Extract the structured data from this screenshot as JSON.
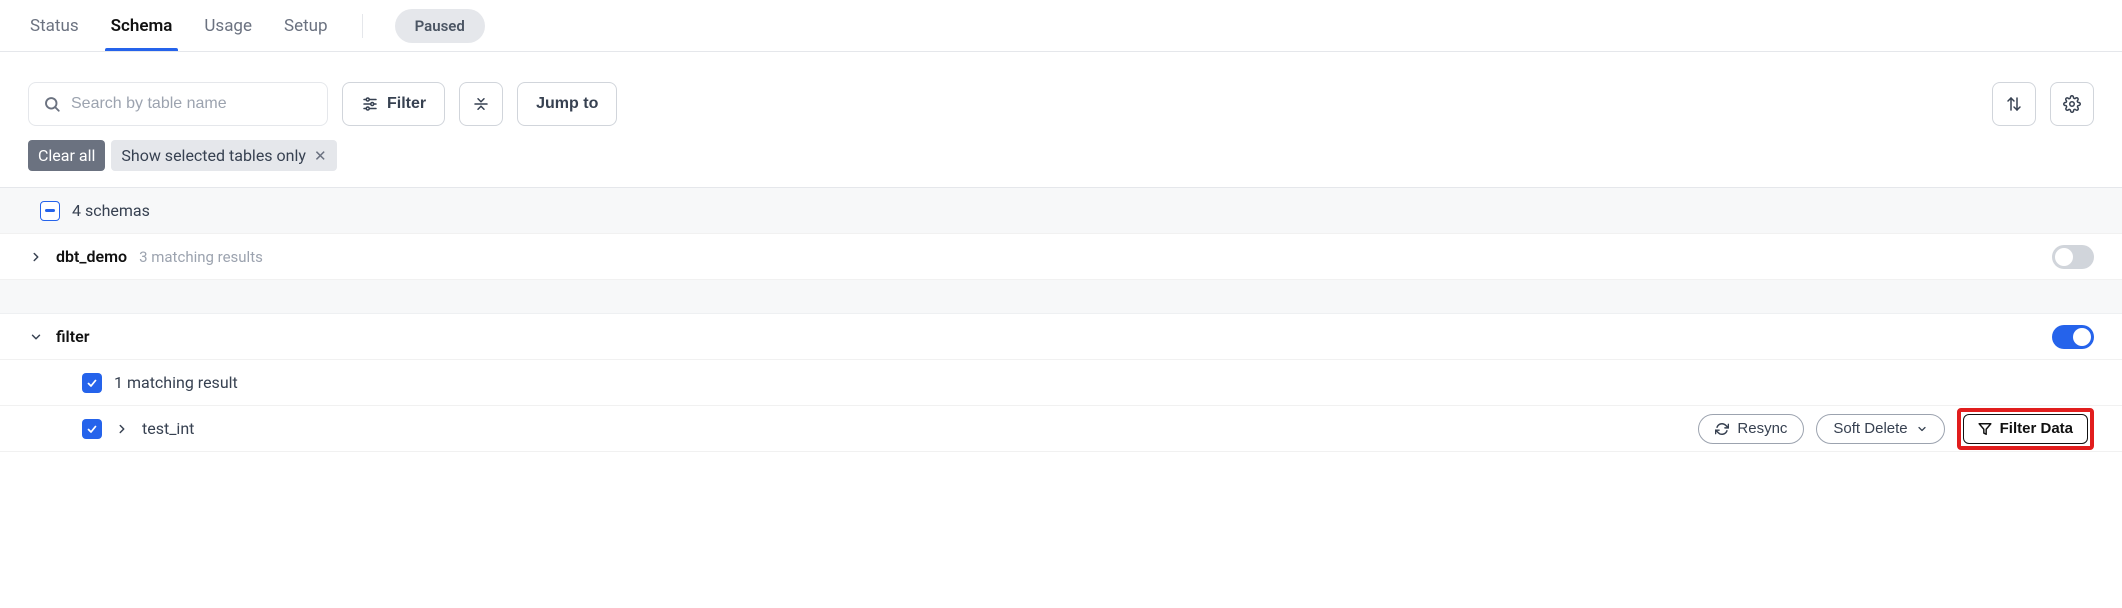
{
  "tabs": {
    "status": "Status",
    "schema": "Schema",
    "usage": "Usage",
    "setup": "Setup"
  },
  "status_pill": "Paused",
  "toolbar": {
    "search_placeholder": "Search by table name",
    "filter_label": "Filter",
    "jump_label": "Jump to"
  },
  "chips": {
    "clear_all": "Clear all",
    "show_selected": "Show selected tables only"
  },
  "header_row": {
    "schema_count": "4 schemas"
  },
  "schemas": [
    {
      "name": "dbt_demo",
      "subtext": "3 matching results",
      "expanded": false,
      "enabled": false
    },
    {
      "name": "filter",
      "expanded": true,
      "enabled": true,
      "match_text": "1 matching result",
      "tables": [
        {
          "name": "test_int",
          "checked": true,
          "actions": {
            "resync": "Resync",
            "delete_mode": "Soft Delete",
            "filter_data": "Filter Data"
          }
        }
      ]
    }
  ]
}
